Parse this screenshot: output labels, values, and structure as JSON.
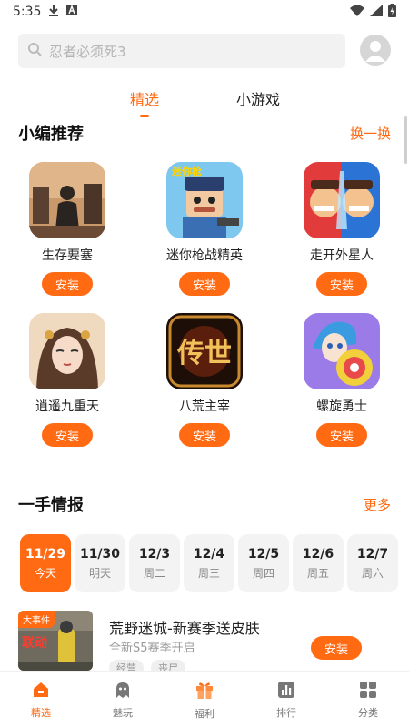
{
  "status_bar": {
    "time": "5:35",
    "icons": [
      "download-icon",
      "font-icon",
      "wifi-icon",
      "signal-icon",
      "battery-icon"
    ]
  },
  "search": {
    "placeholder": "忍者必须死3"
  },
  "tabs": [
    {
      "label": "精选",
      "active": true
    },
    {
      "label": "小游戏",
      "active": false
    }
  ],
  "editor_picks": {
    "title": "小编推荐",
    "action": "换一换",
    "games": [
      {
        "name": "生存要塞",
        "install": "安装",
        "icon": "survival-fortress-icon"
      },
      {
        "name": "迷你枪战精英",
        "install": "安装",
        "icon": "mini-gun-elite-icon"
      },
      {
        "name": "走开外星人",
        "install": "安装",
        "icon": "go-away-alien-icon"
      },
      {
        "name": "逍遥九重天",
        "install": "安装",
        "icon": "xiaoyao-icon"
      },
      {
        "name": "八荒主宰",
        "install": "安装",
        "icon": "bahuang-icon"
      },
      {
        "name": "螺旋勇士",
        "install": "安装",
        "icon": "spiral-warrior-icon"
      }
    ],
    "logo_texts": {
      "mini_gun": "迷你枪",
      "bahuang": "传世"
    }
  },
  "news": {
    "title": "一手情报",
    "action": "更多",
    "dates": [
      {
        "date": "11/29",
        "weekday": "今天",
        "active": true
      },
      {
        "date": "11/30",
        "weekday": "明天",
        "active": false
      },
      {
        "date": "12/3",
        "weekday": "周二",
        "active": false
      },
      {
        "date": "12/4",
        "weekday": "周三",
        "active": false
      },
      {
        "date": "12/5",
        "weekday": "周四",
        "active": false
      },
      {
        "date": "12/6",
        "weekday": "周五",
        "active": false
      },
      {
        "date": "12/7",
        "weekday": "周六",
        "active": false
      }
    ],
    "item": {
      "tag": "大事件",
      "thumb_text": "联动",
      "title": "荒野迷城-新赛季送皮肤",
      "subtitle": "全新S5赛季开启",
      "chips": [
        "经营",
        "丧尸"
      ],
      "install": "安装"
    }
  },
  "bottom_nav": [
    {
      "label": "精选",
      "icon": "home-icon",
      "active": true
    },
    {
      "label": "魅玩",
      "icon": "ghost-icon",
      "active": false
    },
    {
      "label": "福利",
      "icon": "gift-icon",
      "active": false
    },
    {
      "label": "排行",
      "icon": "ranking-icon",
      "active": false
    },
    {
      "label": "分类",
      "icon": "category-grid-icon",
      "active": false
    }
  ],
  "colors": {
    "accent": "#ff6a13",
    "chip_bg": "#efefef",
    "date_bg": "#f3f3f3"
  }
}
